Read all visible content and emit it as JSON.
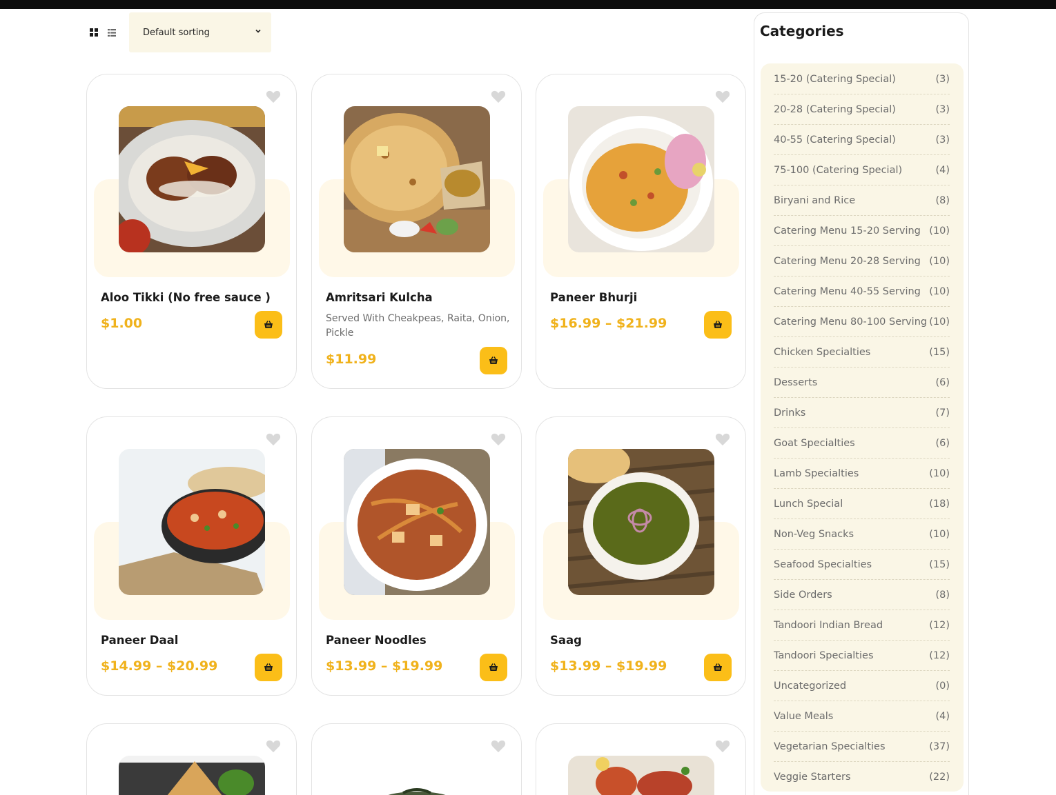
{
  "toolbar": {
    "grid_icon": "grid-view-icon",
    "list_icon": "list-view-icon",
    "sort_selected": "Default sorting"
  },
  "colors": {
    "accent": "#fbbe18",
    "price": "#f0b21c",
    "plate": "#fff8e8",
    "sidebar_bg": "#faf6e6"
  },
  "products": [
    {
      "title": "Aloo Tikki (No free sauce )",
      "description": "",
      "price": "$1.00"
    },
    {
      "title": "Amritsari Kulcha",
      "description": "Served With Cheakpeas, Raita, Onion, Pickle",
      "price": "$11.99"
    },
    {
      "title": "Paneer Bhurji",
      "description": "",
      "price": "$16.99 – $21.99"
    },
    {
      "title": "Paneer Daal",
      "description": "",
      "price": "$14.99 – $20.99"
    },
    {
      "title": "Paneer Noodles",
      "description": "",
      "price": "$13.99 – $19.99"
    },
    {
      "title": "Saag",
      "description": "",
      "price": "$13.99 – $19.99"
    }
  ],
  "sidebar": {
    "title": "Categories",
    "categories": [
      {
        "name": "15-20 (Catering Special)",
        "count": "(3)"
      },
      {
        "name": "20-28 (Catering Special)",
        "count": "(3)"
      },
      {
        "name": "40-55 (Catering Special)",
        "count": "(3)"
      },
      {
        "name": "75-100 (Catering Special)",
        "count": "(4)"
      },
      {
        "name": "Biryani and Rice",
        "count": "(8)"
      },
      {
        "name": "Catering Menu 15-20 Serving",
        "count": "(10)"
      },
      {
        "name": "Catering Menu 20-28 Serving",
        "count": "(10)"
      },
      {
        "name": "Catering Menu 40-55 Serving",
        "count": "(10)"
      },
      {
        "name": "Catering Menu 80-100 Serving",
        "count": "(10)"
      },
      {
        "name": "Chicken Specialties",
        "count": "(15)"
      },
      {
        "name": "Desserts",
        "count": "(6)"
      },
      {
        "name": "Drinks",
        "count": "(7)"
      },
      {
        "name": "Goat Specialties",
        "count": "(6)"
      },
      {
        "name": "Lamb Specialties",
        "count": "(10)"
      },
      {
        "name": "Lunch Special",
        "count": "(18)"
      },
      {
        "name": "Non-Veg Snacks",
        "count": "(10)"
      },
      {
        "name": "Seafood Specialties",
        "count": "(15)"
      },
      {
        "name": "Side Orders",
        "count": "(8)"
      },
      {
        "name": "Tandoori Indian Bread",
        "count": "(12)"
      },
      {
        "name": "Tandoori Specialties",
        "count": "(12)"
      },
      {
        "name": "Uncategorized",
        "count": "(0)"
      },
      {
        "name": "Value Meals",
        "count": "(4)"
      },
      {
        "name": "Vegetarian Specialties",
        "count": "(37)"
      },
      {
        "name": "Veggie Starters",
        "count": "(22)"
      }
    ]
  }
}
